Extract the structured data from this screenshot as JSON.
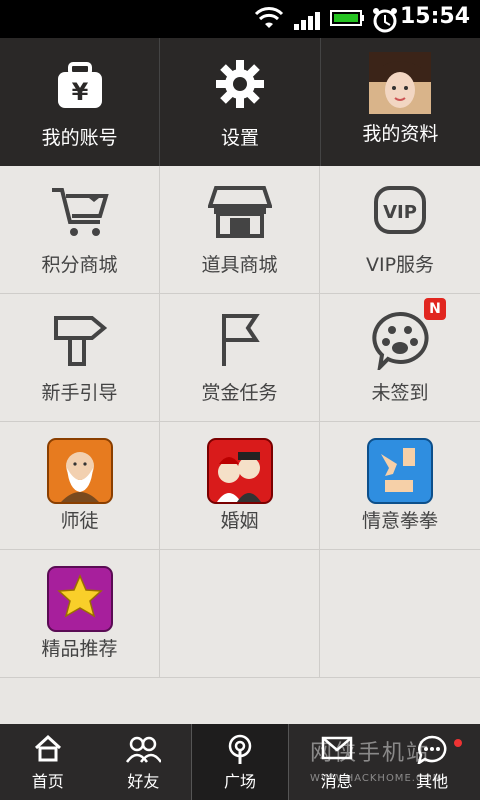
{
  "status": {
    "time": "15:54"
  },
  "top": [
    {
      "label": "我的账号"
    },
    {
      "label": "设置"
    },
    {
      "label": "我的资料"
    }
  ],
  "grid": [
    {
      "label": "积分商城"
    },
    {
      "label": "道具商城"
    },
    {
      "label": "VIP服务"
    },
    {
      "label": "新手引导"
    },
    {
      "label": "赏金任务"
    },
    {
      "label": "未签到",
      "badge": "N"
    },
    {
      "label": "师徒"
    },
    {
      "label": "婚姻"
    },
    {
      "label": "情意拳拳"
    },
    {
      "label": "精品推荐"
    }
  ],
  "tabs": [
    {
      "label": "首页"
    },
    {
      "label": "好友"
    },
    {
      "label": "广场"
    },
    {
      "label": "消息"
    },
    {
      "label": "其他"
    }
  ],
  "watermark": {
    "title": "网侠手机站",
    "url": "WWW.HACKHOME.COM"
  }
}
